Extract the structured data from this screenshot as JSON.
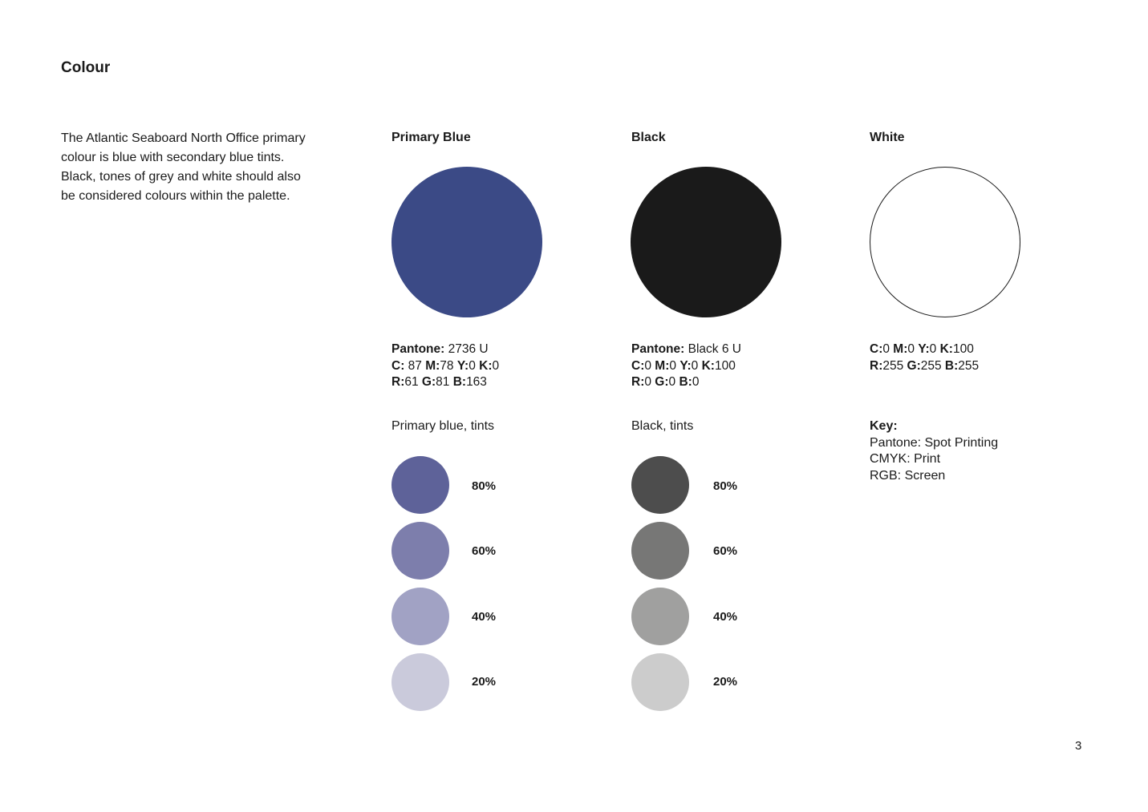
{
  "page": {
    "title": "Colour",
    "intro": "The Atlantic Seaboard North Office primary colour is blue with secondary blue tints. Black, tones of grey and white should also be considered colours within the palette.",
    "page_number": "3"
  },
  "primary_blue": {
    "title": "Primary Blue",
    "color": "#3b4a86",
    "pantone_label": "Pantone:",
    "pantone_value": " 2736 U",
    "c_label": "C:",
    "c_value": " 87 ",
    "m_label": "M:",
    "m_value": "78 ",
    "y_label": "Y:",
    "y_value": "0 ",
    "k_label": "K:",
    "k_value": "0",
    "r_label": "R:",
    "r_value": "61 ",
    "g_label": "G:",
    "g_value": "81 ",
    "b_label": "B:",
    "b_value": "163",
    "tints_title": "Primary blue, tints",
    "tints": [
      {
        "label": "80%",
        "color": "#5e6299"
      },
      {
        "label": "60%",
        "color": "#7d7eac"
      },
      {
        "label": "40%",
        "color": "#a1a2c4"
      },
      {
        "label": "20%",
        "color": "#cacadb"
      }
    ]
  },
  "black": {
    "title": "Black",
    "color": "#1a1a1a",
    "pantone_label": "Pantone:",
    "pantone_value": " Black 6 U",
    "c_label": "C:",
    "c_value": "0 ",
    "m_label": "M:",
    "m_value": "0 ",
    "y_label": "Y:",
    "y_value": "0 ",
    "k_label": "K:",
    "k_value": "100",
    "r_label": "R:",
    "r_value": "0 ",
    "g_label": "G:",
    "g_value": "0 ",
    "b_label": "B:",
    "b_value": "0",
    "tints_title": "Black, tints",
    "tints": [
      {
        "label": "80%",
        "color": "#4d4d4d"
      },
      {
        "label": "60%",
        "color": "#777776"
      },
      {
        "label": "40%",
        "color": "#a0a09f"
      },
      {
        "label": "20%",
        "color": "#cccccc"
      }
    ]
  },
  "white": {
    "title": "White",
    "color": "#ffffff",
    "border_color": "#1a1a1a",
    "c_label": "C:",
    "c_value": "0 ",
    "m_label": "M:",
    "m_value": "0 ",
    "y_label": "Y:",
    "y_value": "0 ",
    "k_label": "K:",
    "k_value": "100",
    "r_label": "R:",
    "r_value": "255 ",
    "g_label": "G:",
    "g_value": "255 ",
    "b_label": "B:",
    "b_value": "255"
  },
  "key": {
    "title": "Key:",
    "lines": [
      "Pantone: Spot Printing",
      "CMYK: Print",
      "RGB: Screen"
    ]
  }
}
